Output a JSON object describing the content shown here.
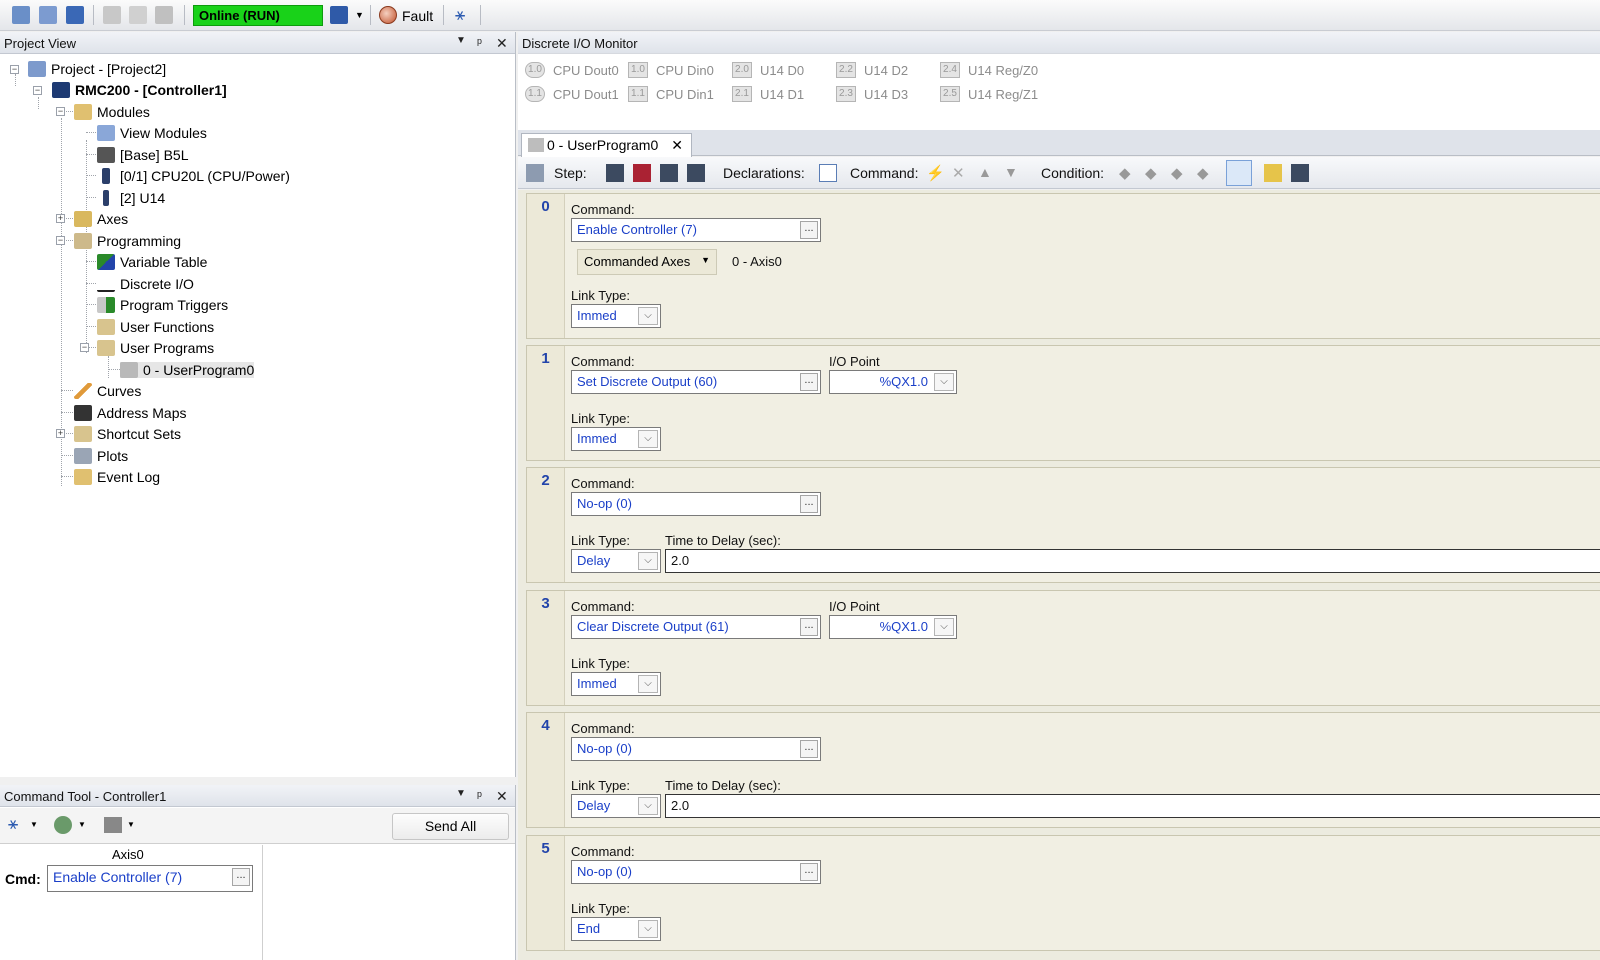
{
  "toolbar": {
    "status": "Online (RUN)",
    "fault_label": "Fault"
  },
  "project_view": {
    "title": "Project View",
    "tree": {
      "project": "Project - [Project2]",
      "controller": "RMC200 - [Controller1]",
      "modules": "Modules",
      "view_modules": "View Modules",
      "base": "[Base] B5L",
      "cpu": "[0/1] CPU20L (CPU/Power)",
      "u14": "[2] U14",
      "axes": "Axes",
      "programming": "Programming",
      "variable_table": "Variable Table",
      "discrete_io": "Discrete I/O",
      "program_triggers": "Program Triggers",
      "user_functions": "User Functions",
      "user_programs": "User Programs",
      "userprogram0": "0 - UserProgram0",
      "curves": "Curves",
      "address_maps": "Address Maps",
      "shortcut_sets": "Shortcut Sets",
      "plots": "Plots",
      "event_log": "Event Log"
    }
  },
  "command_tool": {
    "title": "Command Tool - Controller1",
    "send_all": "Send All",
    "axis": "Axis0",
    "cmd_label": "Cmd:",
    "cmd_value": "Enable Controller (7)",
    "ellipsis": "..."
  },
  "dio_monitor": {
    "title": "Discrete I/O Monitor",
    "points": [
      {
        "id": "1.0",
        "label": "CPU Dout0"
      },
      {
        "id": "1.1",
        "label": "CPU Dout1"
      },
      {
        "id": "1.0",
        "label": "CPU Din0"
      },
      {
        "id": "1.1",
        "label": "CPU Din1"
      },
      {
        "id": "2.0",
        "label": "U14 D0"
      },
      {
        "id": "2.1",
        "label": "U14 D1"
      },
      {
        "id": "2.2",
        "label": "U14 D2"
      },
      {
        "id": "2.3",
        "label": "U14 D3"
      },
      {
        "id": "2.4",
        "label": "U14 Reg/Z0"
      },
      {
        "id": "2.5",
        "label": "U14 Reg/Z1"
      }
    ]
  },
  "editor": {
    "tab_label": "0 - UserProgram0",
    "tab_close": "✕",
    "toolbar": {
      "step": "Step:",
      "declarations": "Declarations:",
      "command": "Command:",
      "condition": "Condition:"
    },
    "labels": {
      "command": "Command:",
      "link_type": "Link Type:",
      "io_point": "I/O Point",
      "time_to_delay": "Time to Delay (sec):"
    },
    "commanded_axes": {
      "label": "Commanded Axes",
      "value": "0 - Axis0"
    },
    "steps": [
      {
        "num": "0",
        "command": "Enable Controller (7)",
        "link": "Immed"
      },
      {
        "num": "1",
        "command": "Set Discrete Output (60)",
        "io_point": "%QX1.0",
        "link": "Immed"
      },
      {
        "num": "2",
        "command": "No-op (0)",
        "link": "Delay",
        "delay": "2.0"
      },
      {
        "num": "3",
        "command": "Clear Discrete Output (61)",
        "io_point": "%QX1.0",
        "link": "Immed"
      },
      {
        "num": "4",
        "command": "No-op (0)",
        "link": "Delay",
        "delay": "2.0"
      },
      {
        "num": "5",
        "command": "No-op (0)",
        "link": "End"
      }
    ]
  }
}
